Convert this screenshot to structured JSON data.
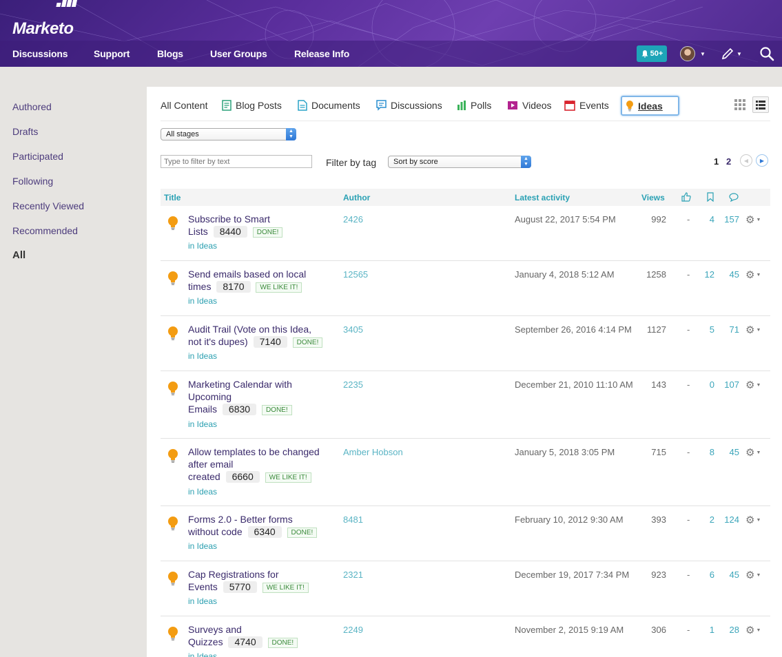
{
  "header": {
    "logo_text": "Marketo",
    "nav": [
      "Discussions",
      "Support",
      "Blogs",
      "User Groups",
      "Release Info"
    ],
    "notification_count": "50+"
  },
  "sidebar": {
    "items": [
      "Authored",
      "Drafts",
      "Participated",
      "Following",
      "Recently Viewed",
      "Recommended",
      "All"
    ],
    "active": "All"
  },
  "tabs": {
    "all": "All Content",
    "blog": "Blog Posts",
    "docs": "Documents",
    "discussions": "Discussions",
    "polls": "Polls",
    "videos": "Videos",
    "events": "Events",
    "ideas": "Ideas"
  },
  "filters": {
    "stage_select": "All stages",
    "text_placeholder": "Type to filter by text",
    "tag_label": "Filter by tag",
    "sort_select": "Sort by score"
  },
  "pager": {
    "page1": "1",
    "page2": "2"
  },
  "table": {
    "headers": {
      "title": "Title",
      "author": "Author",
      "latest": "Latest activity",
      "views": "Views"
    },
    "rows": [
      {
        "title_a": "Subscribe to Smart",
        "title_b": "Lists",
        "score": "8440",
        "status": "DONE!",
        "place": "in Ideas",
        "author": "2426",
        "latest": "August 22, 2017 5:54 PM",
        "views": "992",
        "likes": "-",
        "bookmarks": "4",
        "comments": "157"
      },
      {
        "title_a": "Send emails based on local",
        "title_b": "times",
        "score": "8170",
        "status": "WE LIKE IT!",
        "place": "in Ideas",
        "author": "12565",
        "latest": "January 4, 2018 5:12 AM",
        "views": "1258",
        "likes": "-",
        "bookmarks": "12",
        "comments": "45"
      },
      {
        "title_a": "Audit Trail (Vote on this Idea,",
        "title_b": "not it's dupes)",
        "score": "7140",
        "status": "DONE!",
        "place": "in Ideas",
        "author": "3405",
        "latest": "September 26, 2016 4:14 PM",
        "views": "1127",
        "likes": "-",
        "bookmarks": "5",
        "comments": "71"
      },
      {
        "title_a": "Marketing Calendar with",
        "title_m": "Upcoming",
        "title_b": "Emails",
        "score": "6830",
        "status": "DONE!",
        "place": "in Ideas",
        "author": "2235",
        "latest": "December 21, 2010 11:10 AM",
        "views": "143",
        "likes": "-",
        "bookmarks": "0",
        "comments": "107"
      },
      {
        "title_a": "Allow templates to be changed",
        "title_m": "after email",
        "title_b": "created",
        "score": "6660",
        "status": "WE LIKE IT!",
        "place": "in Ideas",
        "author": "Amber Hobson",
        "latest": "January 5, 2018 3:05 PM",
        "views": "715",
        "likes": "-",
        "bookmarks": "8",
        "comments": "45"
      },
      {
        "title_a": "Forms 2.0 - Better forms",
        "title_b": "without code",
        "score": "6340",
        "status": "DONE!",
        "place": "in Ideas",
        "author": "8481",
        "latest": "February 10, 2012 9:30 AM",
        "views": "393",
        "likes": "-",
        "bookmarks": "2",
        "comments": "124"
      },
      {
        "title_a": "Cap Registrations for",
        "title_b": "Events",
        "score": "5770",
        "status": "WE LIKE IT!",
        "place": "in Ideas",
        "author": "2321",
        "latest": "December 19, 2017 7:34 PM",
        "views": "923",
        "likes": "-",
        "bookmarks": "6",
        "comments": "45"
      },
      {
        "title_a": "Surveys and",
        "title_b": "Quizzes",
        "score": "4740",
        "status": "DONE!",
        "place": "in Ideas",
        "author": "2249",
        "latest": "November 2, 2015 9:19 AM",
        "views": "306",
        "likes": "-",
        "bookmarks": "1",
        "comments": "28"
      }
    ]
  },
  "colors": {
    "brand_purple": "#5a2e9c",
    "teal": "#2aa1b4",
    "bulb": "#f39c12"
  }
}
